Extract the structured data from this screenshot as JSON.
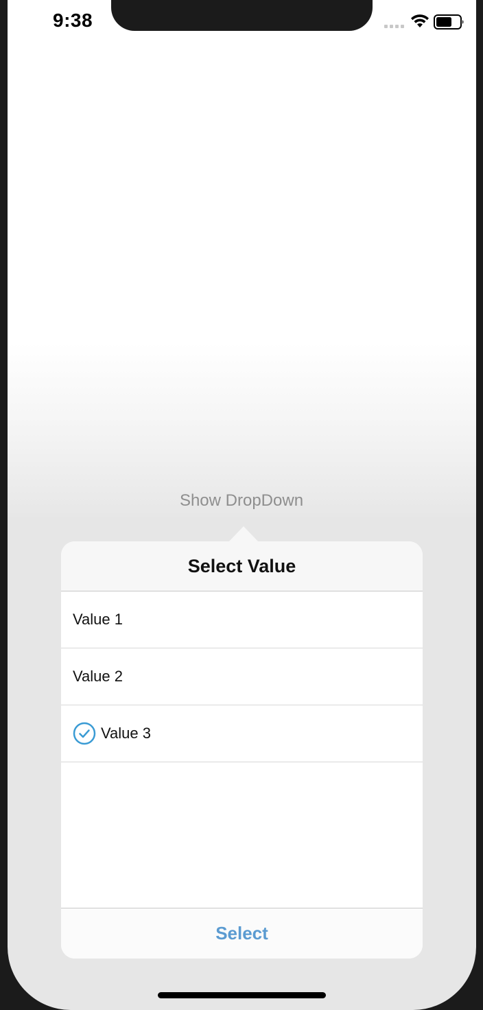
{
  "status_bar": {
    "time": "9:38"
  },
  "main": {
    "show_dropdown_label": "Show DropDown"
  },
  "popover": {
    "title": "Select Value",
    "options": [
      {
        "label": "Value 1",
        "selected": false
      },
      {
        "label": "Value 2",
        "selected": false
      },
      {
        "label": "Value 3",
        "selected": true
      }
    ],
    "select_label": "Select"
  },
  "colors": {
    "accent": "#5b9bd1",
    "check": "#3a9bd4"
  },
  "icons": {
    "signal": "cellular-signal-icon",
    "wifi": "wifi-icon",
    "battery": "battery-icon",
    "check": "checkmark-circle-icon"
  }
}
